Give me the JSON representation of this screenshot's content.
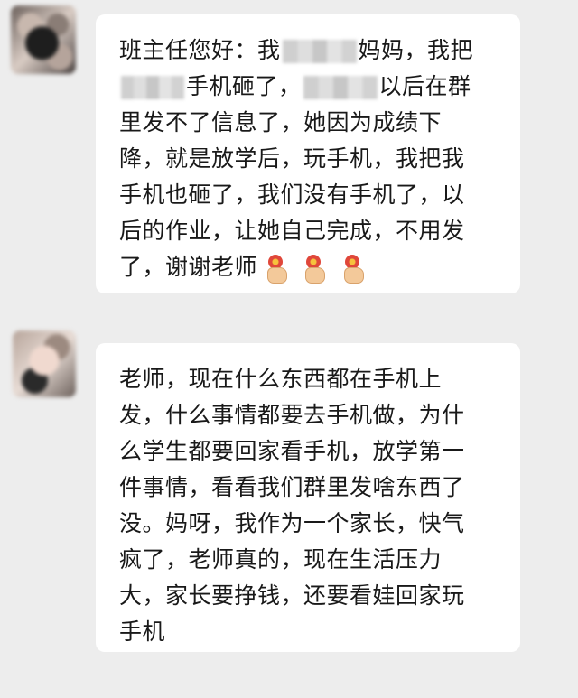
{
  "messages": [
    {
      "lines": [
        [
          "班主任您好：我",
          "妈妈，我把"
        ],
        [
          "手机砸了，",
          "以后在群"
        ],
        [
          "里发不了信息了，她因为成绩下"
        ],
        [
          "降，就是放学后，玩手机，我把我"
        ],
        [
          "手机也砸了，我们没有手机了，以"
        ],
        [
          "后的作业，让她自己完成，不用发"
        ],
        [
          "了，谢谢老师"
        ]
      ],
      "emojis": [
        "flower-hand-icon",
        "flower-hand-icon",
        "flower-hand-icon"
      ]
    },
    {
      "lines": [
        [
          "老师，现在什么东西都在手机上"
        ],
        [
          "发，什么事情都要去手机做，为什"
        ],
        [
          "么学生都要回家看手机，放学第一"
        ],
        [
          "件事情，看看我们群里发啥东西了"
        ],
        [
          "没。妈呀，我作为一个家长，快气"
        ],
        [
          "疯了，老师真的，现在生活压力"
        ],
        [
          "大，家长要挣钱，还要看娃回家玩"
        ],
        [
          "手机"
        ]
      ]
    }
  ]
}
